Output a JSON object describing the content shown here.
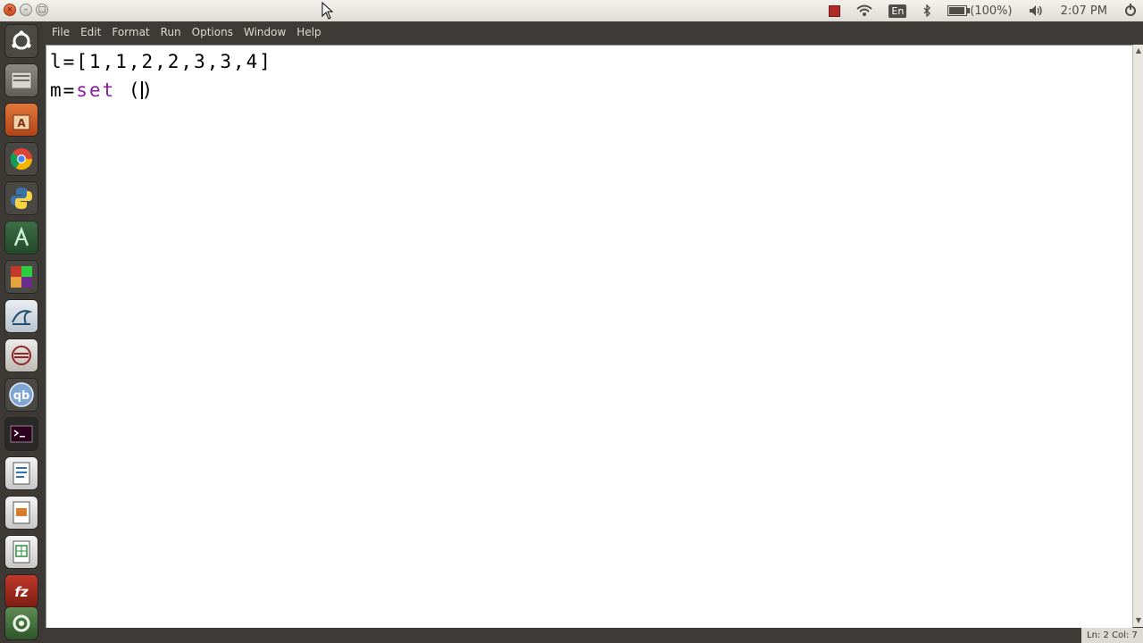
{
  "window_buttons": {
    "close": "×",
    "minimize": "–",
    "maximize": "□"
  },
  "tray": {
    "lang": "En",
    "battery_percent": "(100%)",
    "battery_level": 1.0,
    "clock": "2:07 PM"
  },
  "menu": [
    "File",
    "Edit",
    "Format",
    "Run",
    "Options",
    "Window",
    "Help"
  ],
  "code": {
    "line1": "l=[1,1,2,2,3,3,4]",
    "line2_prefix": "m=",
    "line2_builtin": "set",
    "line2_open": " (",
    "line2_close": ")"
  },
  "status": {
    "text": "Ln: 2 Col: 7"
  },
  "launcher_icons": [
    "dash-icon",
    "files-icon",
    "software-center-icon",
    "chrome-icon",
    "python-icon",
    "android-studio-icon",
    "libreoffice-calc-icon",
    "mysql-workbench-icon",
    "eclipse-icon",
    "qbittorrent-icon",
    "terminal-icon",
    "writer-icon",
    "impress-icon",
    "calc-icon",
    "filezilla-icon",
    "settings-icon"
  ]
}
